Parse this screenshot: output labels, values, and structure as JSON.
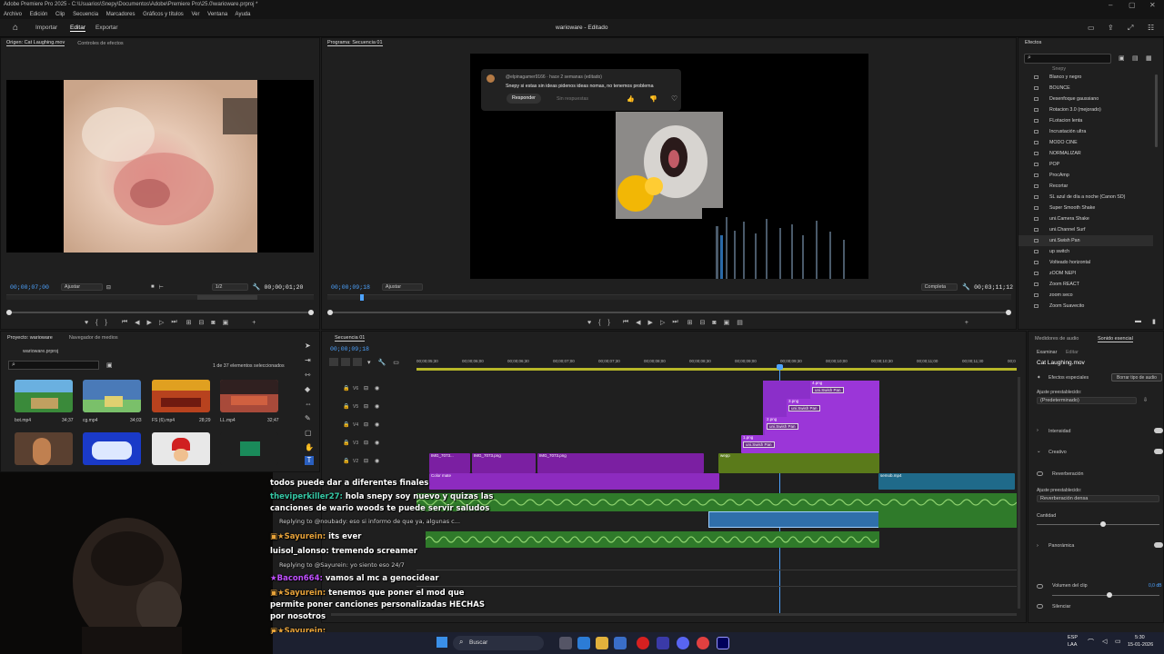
{
  "window": {
    "title": "Adobe Premiere Pro 2025 - C:\\Usuarios\\Snepy\\Documentos\\Adobe\\Premiere Pro\\25.0\\warioware.prproj *",
    "menu": [
      "Archivo",
      "Edición",
      "Clip",
      "Secuencia",
      "Marcadores",
      "Gráficos y títulos",
      "Ver",
      "Ventana",
      "Ayuda"
    ]
  },
  "header": {
    "tabs": [
      "Importar",
      "Editar",
      "Exportar"
    ],
    "active_tab": "Editar",
    "project_title": "warioware - Editado"
  },
  "source_monitor": {
    "tab_active": "Origen: Cat Laughing.mov",
    "tab_other": "Controles de efectos",
    "timecode_left": "00;00;07;00",
    "fit": "Ajustar",
    "resolution": "1/2",
    "timecode_right": "00;00;01;20"
  },
  "program_monitor": {
    "tab": "Programa: Secuencia 01",
    "timecode_left": "00;00;09;18",
    "fit": "Ajustar",
    "quality": "Completa",
    "timecode_right": "00;03;11;12",
    "comment": {
      "user": "@elpinagamer9166 · hace 2 semanas (editado)",
      "text": "Snepy si estas sin ideas pidenos ideas nomas, no tenemos problema",
      "reply_button": "Responder",
      "replies_label": "Sin respuestas"
    }
  },
  "effects_panel": {
    "title": "Efectos",
    "search_placeholder": "",
    "partial_top": "Snepy",
    "items": [
      "Blanco y negro",
      "BOUNCE",
      "Desenfoque gaussiano",
      "Rotacion 3.0 (mejorado)",
      "FLotacion lenta",
      "Incrustación ultra",
      "MODO CINE",
      "NORMALIZAR",
      "POP",
      "ProcAmp",
      "Recortar",
      "SL azul de día a noche (Canon SD)",
      "Super Smooth Shake",
      "uni.Camera Shake",
      "uni.Channel Surf",
      "uni.Swish Pan",
      "up switch",
      "Volteado horizontal",
      "zOOM NEPI",
      "Zoom REACT",
      "zoom seco",
      "Zoom Suavecito"
    ],
    "selected_item": "uni.Swish Pan"
  },
  "project_panel": {
    "tab": "Proyecto: warioware",
    "tab_other": "Navegador de medios",
    "file": "warioware.prproj",
    "selection_info": "1 de 37 elementos seleccionados",
    "thumbs": [
      {
        "name": "bot.mp4",
        "duration": "34;37",
        "color": "#3a8a3a"
      },
      {
        "name": "cg.mp4",
        "duration": "34;03",
        "color": "#4a7ab8"
      },
      {
        "name": "FS (6).mp4",
        "duration": "28;29",
        "color": "#b8421e"
      },
      {
        "name": "LL.mp4",
        "duration": "32;47",
        "color": "#a84a3a"
      }
    ]
  },
  "timeline": {
    "tab": "Secuencia 01",
    "timecode": "00;00;09;18",
    "ruler": [
      "00;00;05;30",
      "00;00;06;00",
      "00;00;06;30",
      "00;00;07;00",
      "00;00;07;30",
      "00;00;08;00",
      "00;00;08;30",
      "00;00;09;00",
      "00;00;09;30",
      "00;00;10;00",
      "00;00;10;30",
      "00;00;11;00",
      "00;00;11;30",
      "00;0"
    ],
    "tracks": [
      "V6",
      "V5",
      "V4",
      "V3",
      "V2"
    ],
    "clips": [
      {
        "label": "4.png",
        "fx": "uni.Swish Pan"
      },
      {
        "label": "3.png",
        "fx": "uni.Swish Pan"
      },
      {
        "label": "2.png",
        "fx": "uni.Swish Pan"
      },
      {
        "label": "1.png",
        "fx": "uni.Swish Pan"
      },
      {
        "label": "IMG_7073..."
      },
      {
        "label": "IMG_7073.png"
      },
      {
        "label": "IMG_7073.png"
      },
      {
        "label": "wepp"
      },
      {
        "label": "Color mate"
      },
      {
        "label": "semob.mp4"
      }
    ]
  },
  "essential_sound": {
    "tab_left": "Medidores de audio",
    "tab_active": "Sonido esencial",
    "subtab_1": "Examinar",
    "subtab_2": "Editar",
    "clip": "Cat Laughing.mov",
    "effects_label": "Efectos especiales",
    "clear_button": "Borrar tipo de audio",
    "preset_label": "Ajuste preestablecido:",
    "preset_value": "(Predeterminado)",
    "sections": [
      "Intensidad",
      "Creativo"
    ],
    "reverb": "Reverberación",
    "preset2_label": "Ajuste preestablecido:",
    "preset2_value": "Reverberación densa",
    "amount": "Cantidad",
    "panning": "Panorámica",
    "volume": "Volumen del clip",
    "mute": "Silenciar",
    "volume_value": "0,0 dB"
  },
  "chat": [
    {
      "type": "line",
      "user": "",
      "text": "todos puede dar a diferentes finales",
      "color": "#ffffff"
    },
    {
      "type": "line",
      "user": "theviperkiller27:",
      "text": "hola snepy soy nuevo y quizas las",
      "color": "#36c9a6"
    },
    {
      "type": "line",
      "user": "",
      "text": "canciones de wario woods te puede servir saludos",
      "color": "#ffffff"
    },
    {
      "type": "reply",
      "text": "Replying to @noubady: eso si informo de que ya, algunas c..."
    },
    {
      "type": "line",
      "user": "Sayurein:",
      "text": "its ever",
      "color": "#e8a33a"
    },
    {
      "type": "line",
      "user": "luisol_alonso:",
      "text": "tremendo screamer",
      "color": "#ffffff"
    },
    {
      "type": "reply",
      "text": "Replying to @Sayurein: yo siento eso 24/7"
    },
    {
      "type": "line",
      "user": "Bacon664:",
      "text": "vamos al mc a genocidear",
      "color": "#c050ff"
    },
    {
      "type": "line",
      "user": "Sayurein:",
      "text": "tenemos que poner el mod que",
      "color": "#e8a33a"
    },
    {
      "type": "line",
      "user": "",
      "text": "permite poner canciones personalizadas HECHAS",
      "color": "#ffffff"
    },
    {
      "type": "line",
      "user": "",
      "text": "por nosotros",
      "color": "#ffffff"
    },
    {
      "type": "line",
      "user": "Sayurein:",
      "text": "",
      "color": "#e8a33a"
    }
  ],
  "taskbar": {
    "search": "Buscar",
    "lang": "ESP",
    "region": "LAA",
    "time": "5:30",
    "date": "15-01-2026"
  }
}
